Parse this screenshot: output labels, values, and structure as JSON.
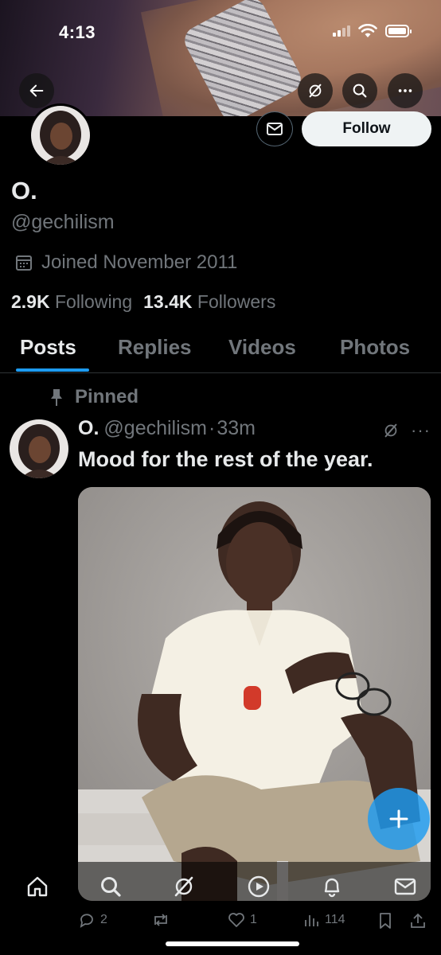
{
  "status_bar": {
    "time": "4:13"
  },
  "header": {
    "back_icon": "arrow-left-icon",
    "grok_icon": "grok-icon",
    "search_icon": "search-icon",
    "more_icon": "more-horizontal-icon"
  },
  "profile": {
    "display_name": "O.",
    "handle": "@gechilism",
    "joined": "Joined November 2011",
    "following_count": "2.9K",
    "following_label": "Following",
    "followers_count": "13.4K",
    "followers_label": "Followers",
    "follow_label": "Follow"
  },
  "tabs": [
    {
      "label": "Posts",
      "active": true
    },
    {
      "label": "Replies",
      "active": false
    },
    {
      "label": "Videos",
      "active": false
    },
    {
      "label": "Photos",
      "active": false
    }
  ],
  "post": {
    "pinned_label": "Pinned",
    "author_name": "O.",
    "author_handle": "@gechilism",
    "separator": "·",
    "time": "33m",
    "text": "Mood for the rest of the year.",
    "more": "···",
    "replies": "2",
    "reposts": "",
    "likes": "1",
    "views": "114"
  },
  "bottom_nav": [
    "home-icon",
    "search-icon",
    "grok-icon",
    "play-icon",
    "bell-icon",
    "mail-icon"
  ],
  "colors": {
    "accent": "#1d9bf0",
    "muted": "#71767b",
    "text": "#e7e9ea",
    "bg": "#000000"
  }
}
